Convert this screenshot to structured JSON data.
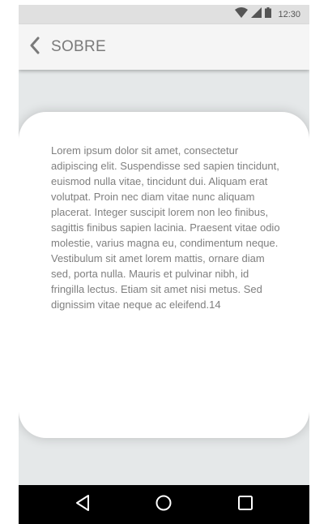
{
  "status_bar": {
    "time": "12:30",
    "icons": [
      "wifi-icon",
      "signal-icon",
      "battery-icon"
    ]
  },
  "app_bar": {
    "back_icon": "chevron-left-icon",
    "title": "SOBRE"
  },
  "card": {
    "body": "Lorem ipsum dolor sit amet, consectetur adipiscing elit. Suspendisse sed sapien tincidunt, euismod nulla vitae, tincidunt dui. Aliquam erat volutpat. Proin nec diam vitae nunc aliquam placerat. Integer suscipit lorem non leo finibus, sagittis finibus sapien lacinia. Praesent vitae odio molestie, varius magna eu, condimentum neque. Vestibulum sit amet lorem mattis, ornare diam sed, porta nulla. Mauris et pulvinar nibh, id fringilla lectus. Etiam sit amet nisi metus. Sed dignissim vitae neque ac eleifend.14"
  },
  "nav_bar": {
    "buttons": [
      "back-triangle-icon",
      "home-circle-icon",
      "recents-square-icon"
    ]
  },
  "colors": {
    "background": "#e5e8e9",
    "app_bar": "#f5f5f5",
    "status_bar": "#e0e0e0",
    "card": "#ffffff",
    "text": "#7f7f7f",
    "nav_bar": "#000000"
  }
}
